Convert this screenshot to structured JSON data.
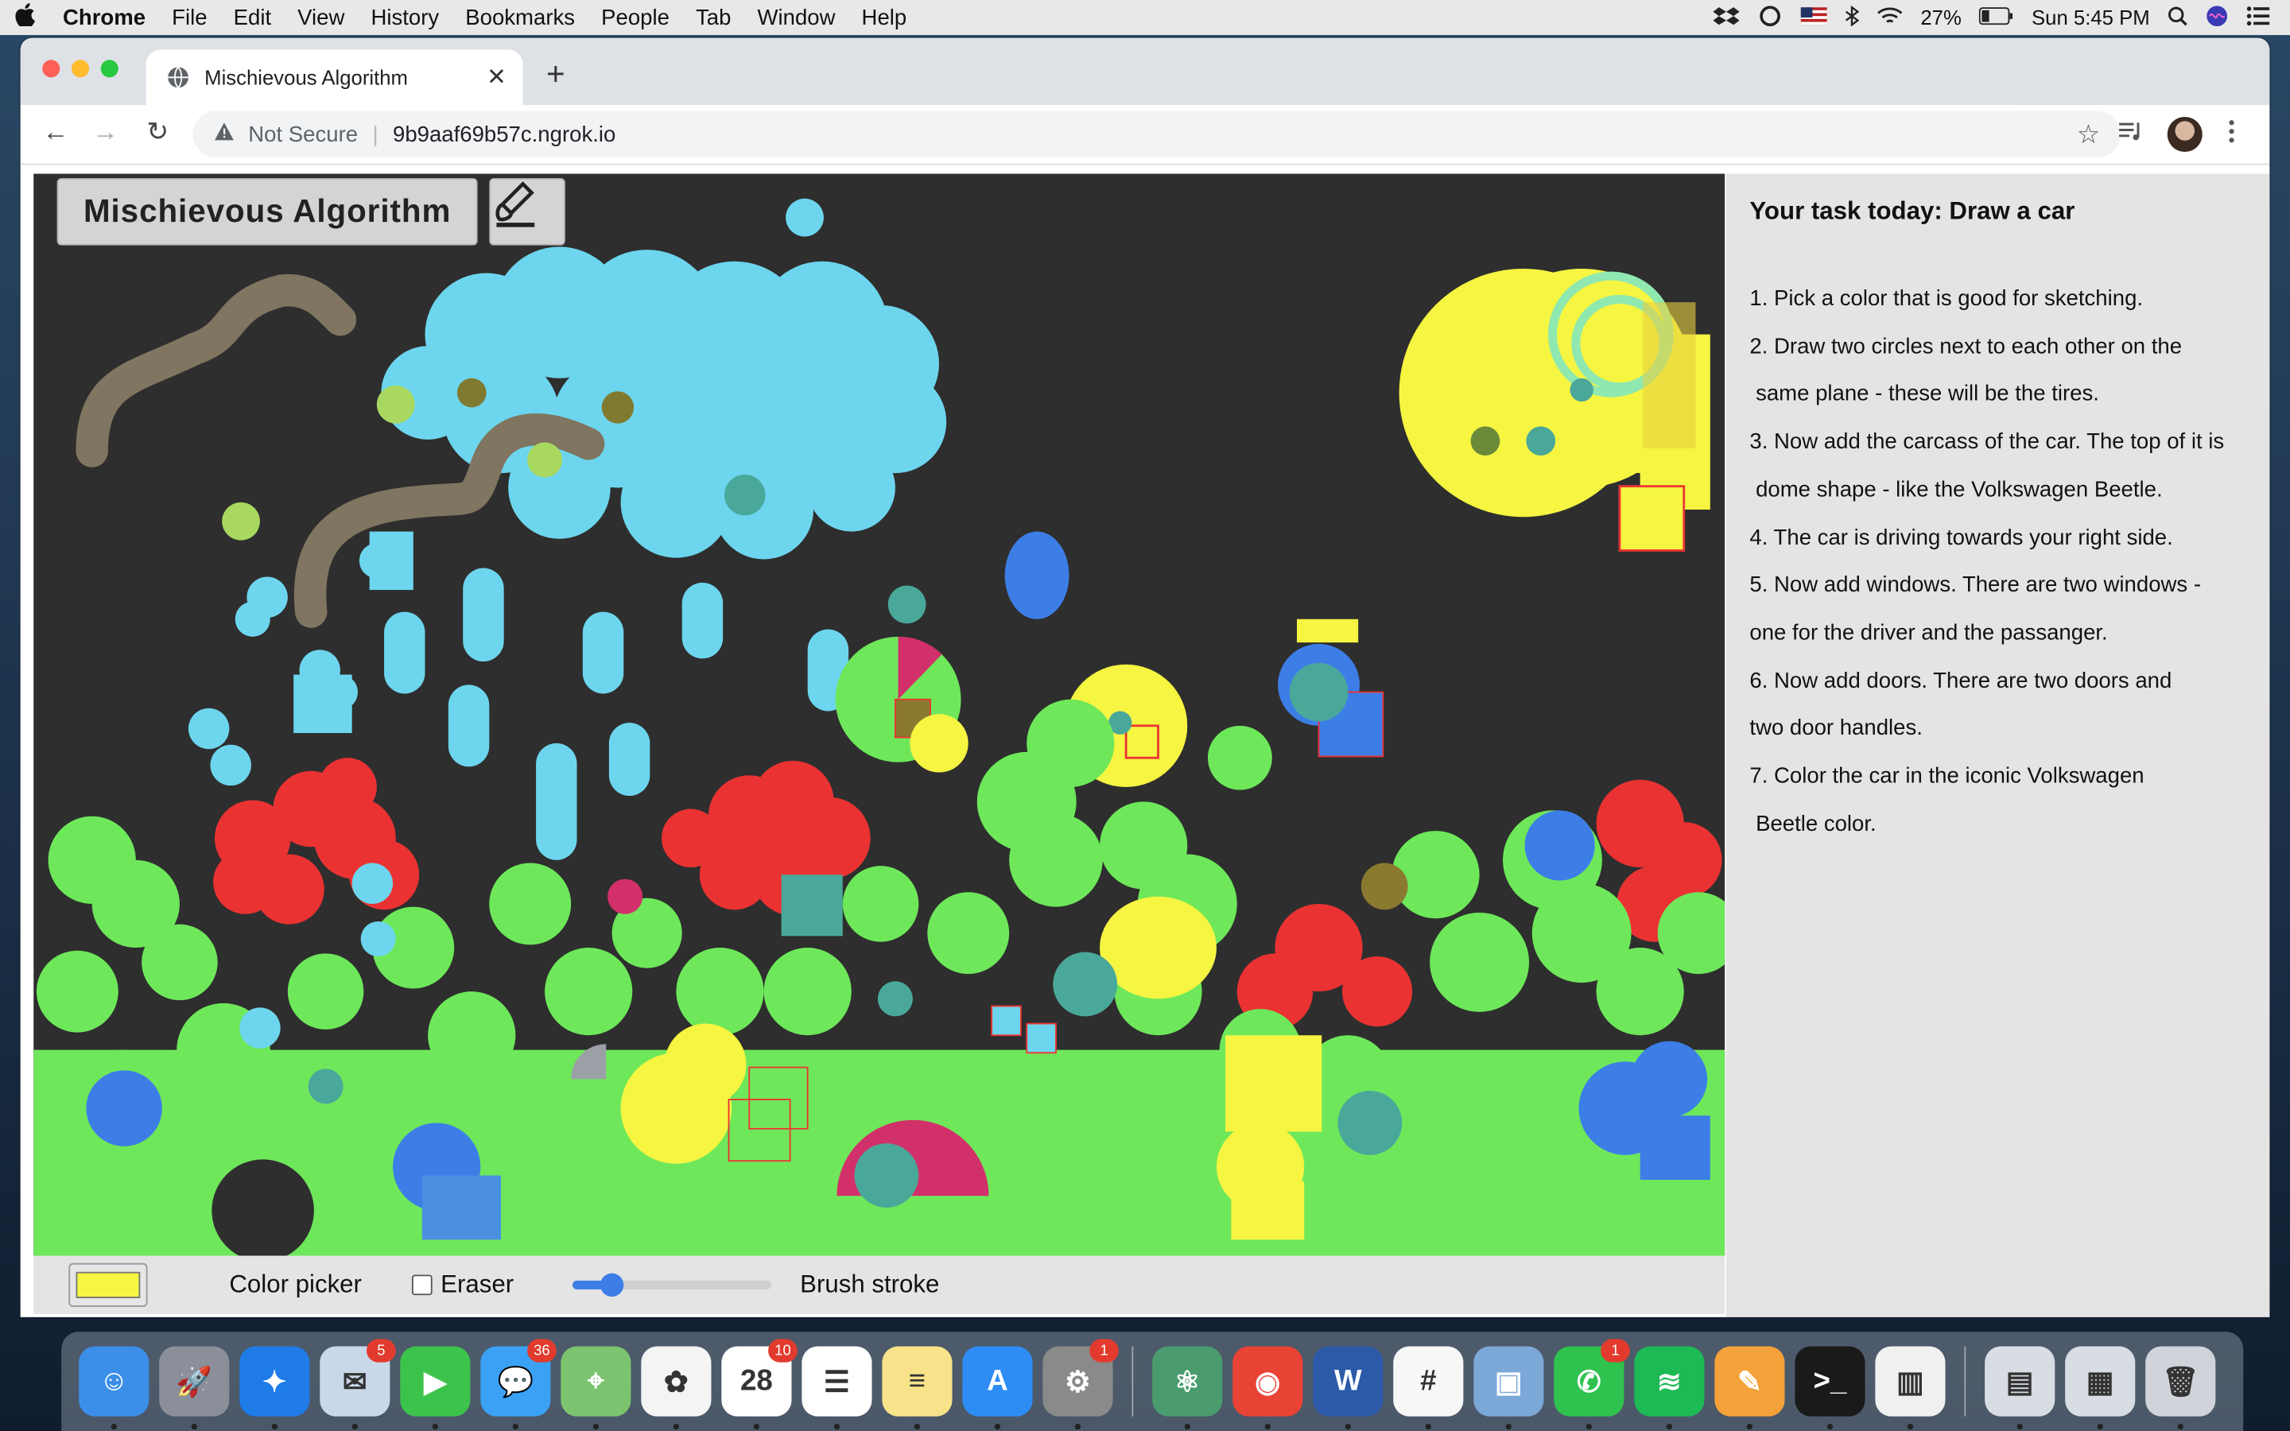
{
  "menubar": {
    "app": "Chrome",
    "items": [
      "File",
      "Edit",
      "View",
      "History",
      "Bookmarks",
      "People",
      "Tab",
      "Window",
      "Help"
    ],
    "battery": "27%",
    "clock": "Sun 5:45 PM"
  },
  "browser": {
    "tab_title": "Mischievous Algorithm",
    "not_secure": "Not Secure",
    "url": "9b9aaf69b57c.ngrok.io"
  },
  "app": {
    "logo": "Mischievous Algorithm",
    "task_title": "Your task today: Draw a car",
    "steps": [
      "1. Pick a color that is good for sketching.",
      "2. Draw two circles next to each other on the",
      " same plane - these will be the tires.",
      "3. Now add the carcass of the car. The top of it is",
      " dome shape - like the Volkswagen Beetle.",
      "4. The car is driving towards your right side.",
      "5. Now add windows. There are two windows -",
      "one for the driver and the passanger.",
      "6. Now add doors. There are two doors and",
      "two door handles.",
      "7. Color the car in the iconic Volkswagen",
      " Beetle color."
    ],
    "controls": {
      "color_picker_label": "Color picker",
      "eraser_label": "Eraser",
      "brush_label": "Brush stroke",
      "selected_color": "#f5f542",
      "brush_level": 0.2
    }
  },
  "dock": {
    "icons": [
      {
        "name": "finder-icon",
        "color": "#3b8fe8",
        "glyph": "☺"
      },
      {
        "name": "launchpad-icon",
        "color": "#8a8f99",
        "glyph": "🚀"
      },
      {
        "name": "safari-icon",
        "color": "#1f7be8",
        "glyph": "✦"
      },
      {
        "name": "mail-icon",
        "color": "#c9d8e8",
        "glyph": "✉",
        "badge": "5"
      },
      {
        "name": "facetime-icon",
        "color": "#3cc34b",
        "glyph": "▶"
      },
      {
        "name": "messages-icon",
        "color": "#3aa1f5",
        "glyph": "💬",
        "badge": "36"
      },
      {
        "name": "maps-icon",
        "color": "#7cc46f",
        "glyph": "⌖"
      },
      {
        "name": "photos-icon",
        "color": "#f4f4f4",
        "glyph": "✿"
      },
      {
        "name": "calendar-icon",
        "color": "#ffffff",
        "glyph": "28",
        "badge": "10"
      },
      {
        "name": "reminders-icon",
        "color": "#ffffff",
        "glyph": "☰"
      },
      {
        "name": "notes-icon",
        "color": "#f8e38a",
        "glyph": "≡"
      },
      {
        "name": "app-store-icon",
        "color": "#2e8df5",
        "glyph": "A"
      },
      {
        "name": "system-preferences-icon",
        "color": "#8a8a8a",
        "glyph": "⚙",
        "badge": "1"
      },
      {
        "name": "atom-icon",
        "color": "#4a9c6f",
        "glyph": "⚛"
      },
      {
        "name": "chrome-icon",
        "color": "#e84335",
        "glyph": "◉"
      },
      {
        "name": "word-icon",
        "color": "#2b5aa8",
        "glyph": "W"
      },
      {
        "name": "slack-icon",
        "color": "#f7f7f7",
        "glyph": "#"
      },
      {
        "name": "preview-icon",
        "color": "#7ca8d8",
        "glyph": "▣"
      },
      {
        "name": "whatsapp-icon",
        "color": "#2fc24f",
        "glyph": "✆",
        "badge": "1"
      },
      {
        "name": "spotify-icon",
        "color": "#1db954",
        "glyph": "≋"
      },
      {
        "name": "pages-icon",
        "color": "#f4a23a",
        "glyph": "✎"
      },
      {
        "name": "terminal-icon",
        "color": "#1a1a1a",
        "glyph": ">_"
      },
      {
        "name": "numbers-icon",
        "color": "#f0f0f0",
        "glyph": "▥"
      },
      {
        "name": "documents-folder-icon",
        "color": "#d8dde4",
        "glyph": "▤"
      },
      {
        "name": "downloads-folder-icon",
        "color": "#d8dde4",
        "glyph": "▦"
      },
      {
        "name": "trash-icon",
        "color": "#d0d4da",
        "glyph": "🗑"
      }
    ]
  }
}
